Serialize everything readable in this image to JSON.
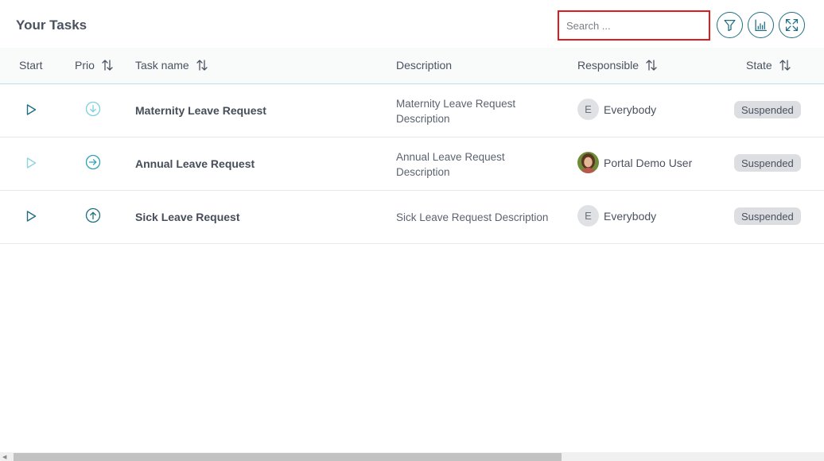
{
  "header": {
    "title": "Your Tasks",
    "search_placeholder": "Search ...",
    "filter_icon": "filter-icon",
    "columns_icon": "column-chart-icon",
    "fullscreen_icon": "expand-icon"
  },
  "columns": {
    "start": "Start",
    "prio": "Prio",
    "task_name": "Task name",
    "description": "Description",
    "responsible": "Responsible",
    "state": "State"
  },
  "tasks": [
    {
      "name": "Maternity Leave Request",
      "description_lines": [
        "Maternity Leave Request",
        "Description"
      ],
      "responsible": "Everybody",
      "avatar_letter": "E",
      "state": "Suspended",
      "priority_icon": "arrow-down-circle-icon"
    },
    {
      "name": "Annual Leave Request",
      "description_lines": [
        "Annual Leave Request",
        "Description"
      ],
      "responsible": "Portal Demo User",
      "avatar_letter": "",
      "state": "Suspended",
      "priority_icon": "arrow-right-circle-icon"
    },
    {
      "name": "Sick Leave Request",
      "description_lines": [
        "Sick Leave Request Description"
      ],
      "responsible": "Everybody",
      "avatar_letter": "E",
      "state": "Suspended",
      "priority_icon": "arrow-up-circle-icon"
    }
  ],
  "colors": {
    "accent": "#1f6f84",
    "prio_low": "#7fd0dc",
    "prio_normal": "#2fa4b6",
    "prio_high": "#1f6f84",
    "search_highlight": "#e01b1b"
  }
}
